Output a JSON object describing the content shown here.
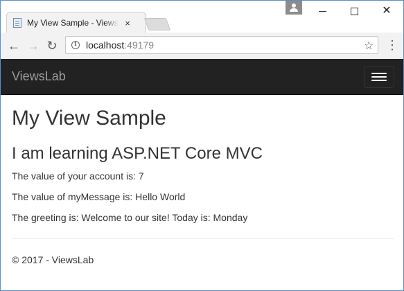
{
  "browser": {
    "tab_title": "My View Sample - ViewsLab",
    "tab_close": "×",
    "url_host": "localhost",
    "url_port": ":49179",
    "icons": {
      "back": "arrow-left-icon",
      "forward": "arrow-right-icon",
      "reload": "reload-icon",
      "info": "info-icon",
      "star": "star-icon",
      "menu": "kebab-menu-icon"
    }
  },
  "navbar": {
    "brand": "ViewsLab"
  },
  "main": {
    "heading": "My View Sample",
    "subheading": "I am learning ASP.NET Core MVC",
    "lines": [
      "The value of your account is: 7",
      "The value of myMessage is: Hello World",
      "The greeting is: Welcome to our site! Today is: Monday"
    ]
  },
  "footer": {
    "text": "© 2017 - ViewsLab"
  },
  "colors": {
    "navbar_bg": "#222222",
    "brand_text": "#9d9d9d",
    "body_text": "#333333",
    "window_border": "#5a8fc9"
  }
}
